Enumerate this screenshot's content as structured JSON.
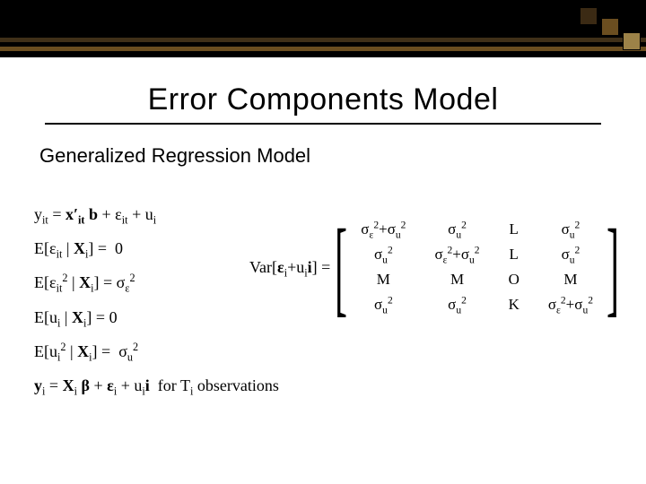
{
  "banner": {
    "bg": "#000000",
    "stripe1": "#403018",
    "stripe2": "#6b4e20",
    "sq_dark": "#3b2a14",
    "sq_mid": "#6b4e20",
    "sq_light": "#9c8248"
  },
  "title": "Error Components Model",
  "subtitle": "Generalized Regression Model",
  "equations": {
    "line1": "y_{it} = x'_{it} b + ε_{it} + u_i",
    "line2": "E[ε_{it} | X_i] = 0",
    "line3": "E[ε_{it}^2 | X_i] = σ_ε^2",
    "line4": "E[u_i | X_i] = 0",
    "line5": "E[u_i^2 | X_i] = σ_u^2",
    "line6": "y_i = X_i β + ε_i + u_i i  for T_i observations"
  },
  "variance_label": "Var[ε_i + u_i i] =",
  "matrix": {
    "rows": [
      [
        "σ_ε^2 + σ_u^2",
        "σ_u^2",
        "L",
        "σ_u^2"
      ],
      [
        "σ_u^2",
        "σ_ε^2 + σ_u^2",
        "L",
        "σ_u^2"
      ],
      [
        "M",
        "M",
        "O",
        "M"
      ],
      [
        "σ_u^2",
        "σ_u^2",
        "K",
        "σ_ε^2 + σ_u^2"
      ]
    ]
  },
  "chart_data": {
    "type": "table",
    "title": "Var[ε_i + u_i i]",
    "rows": [
      [
        "σ_ε^2+σ_u^2",
        "σ_u^2",
        "L",
        "σ_u^2"
      ],
      [
        "σ_u^2",
        "σ_ε^2+σ_u^2",
        "L",
        "σ_u^2"
      ],
      [
        "M",
        "M",
        "O",
        "M"
      ],
      [
        "σ_u^2",
        "σ_u^2",
        "K",
        "σ_ε^2+σ_u^2"
      ]
    ]
  }
}
